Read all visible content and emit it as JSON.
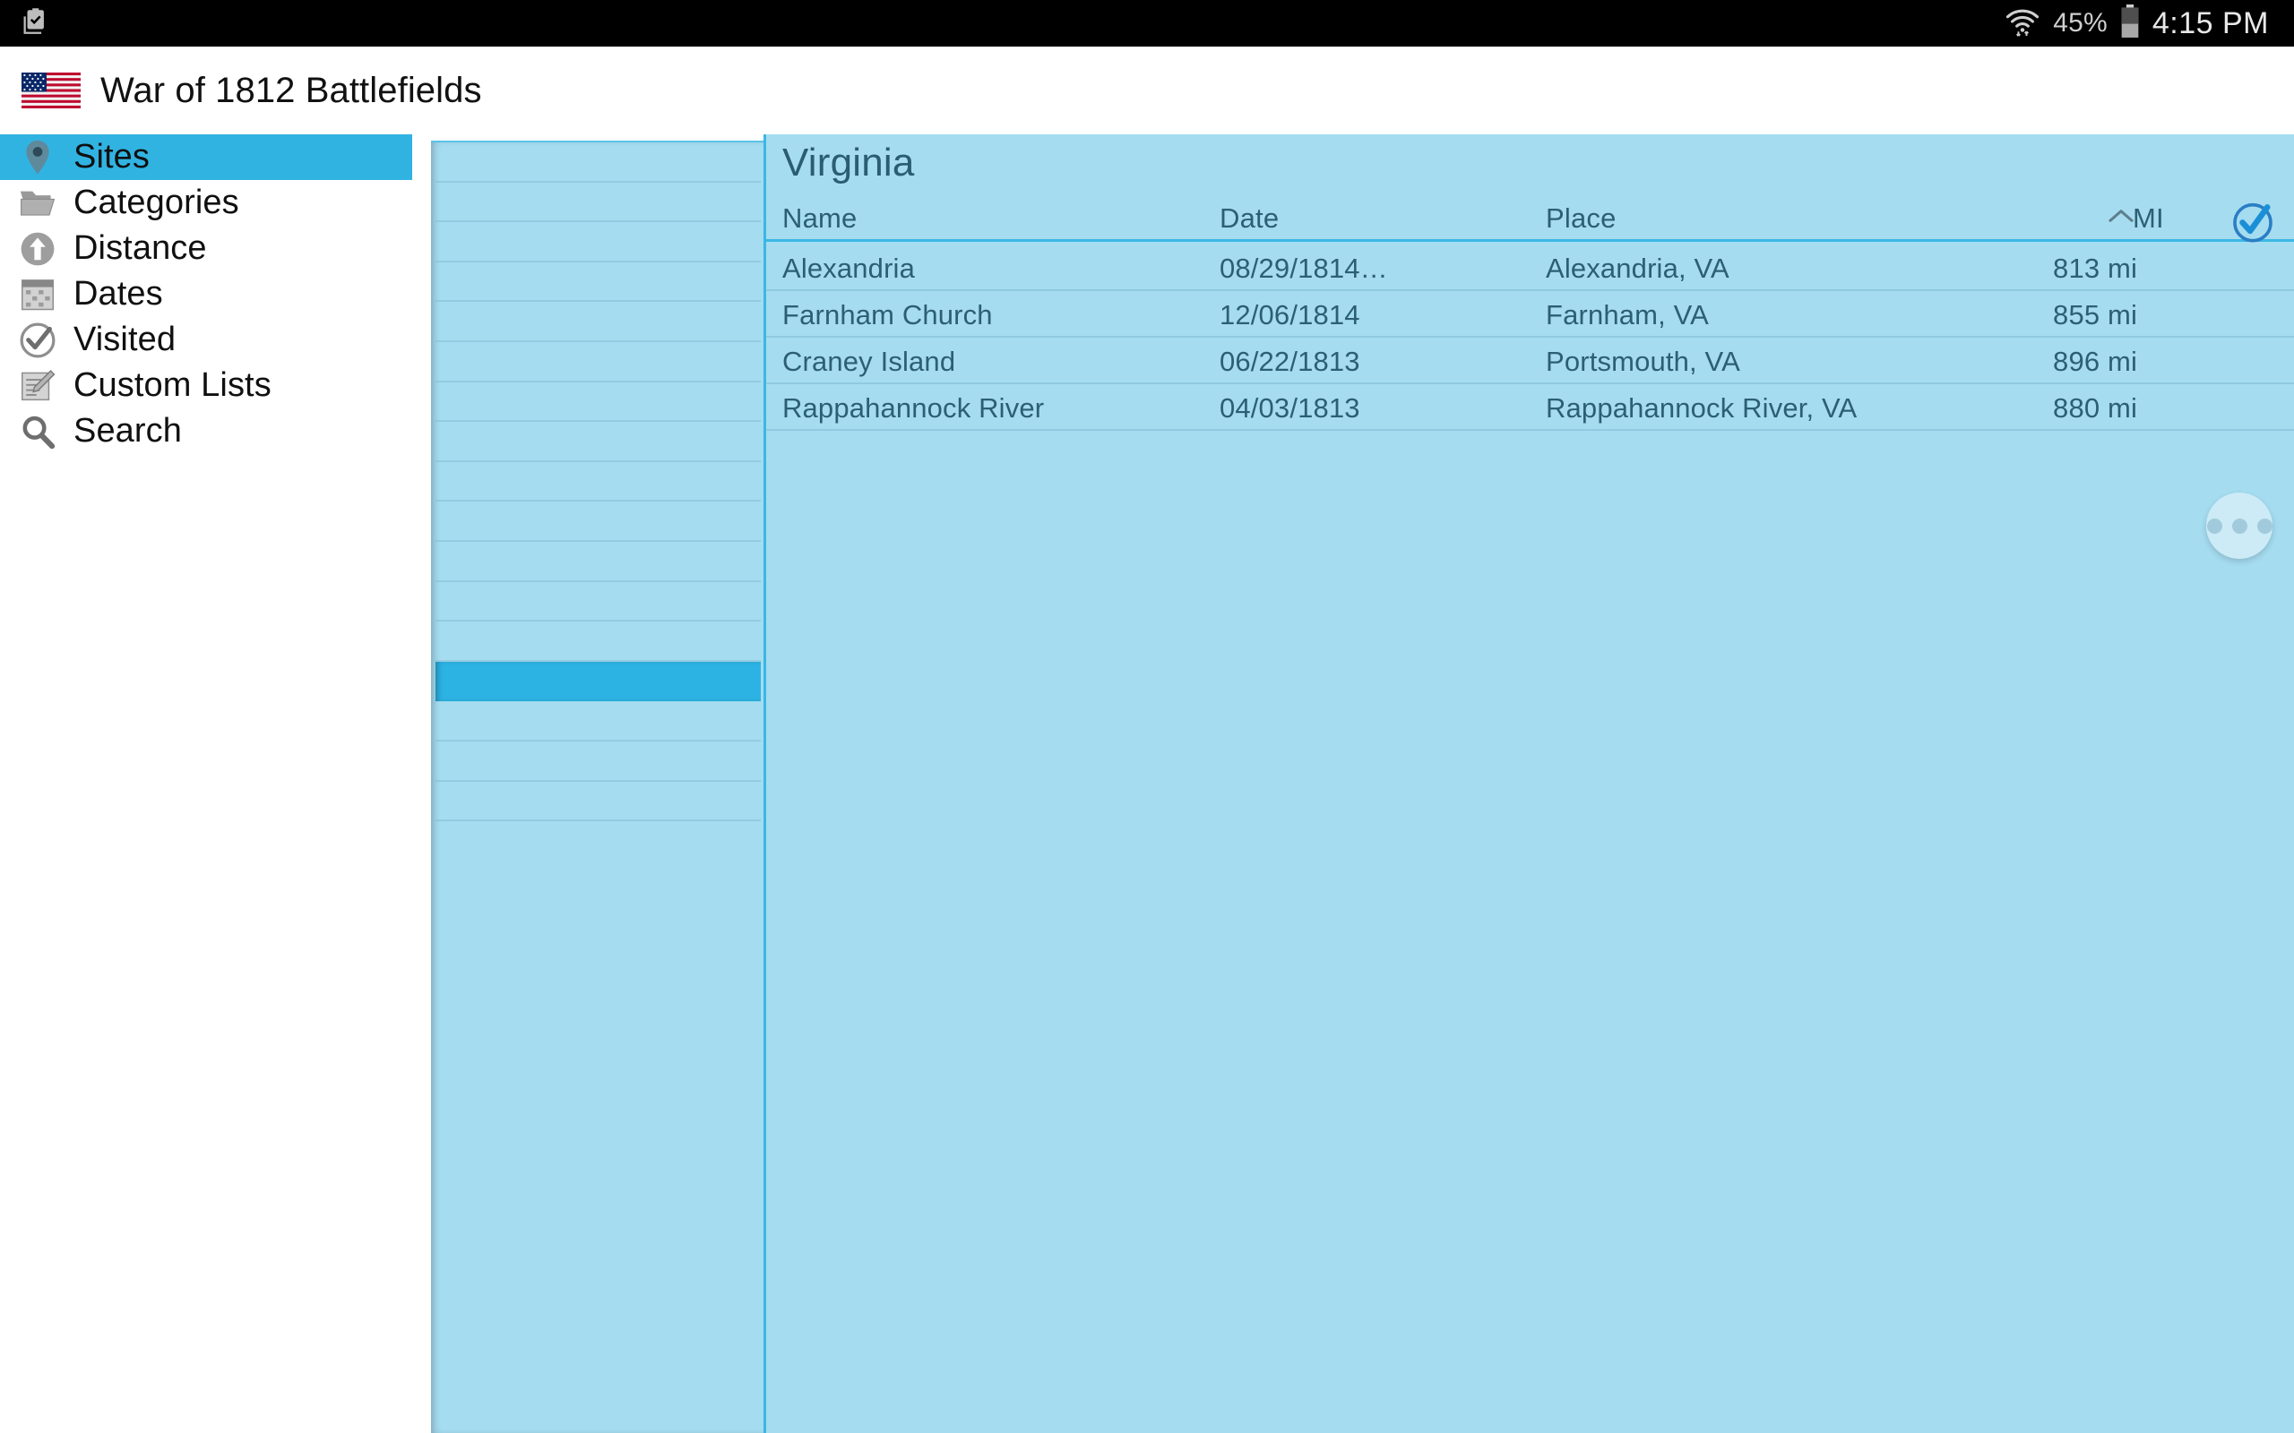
{
  "status_bar": {
    "notification_icon": "clipboard-check-icon",
    "wifi_icon": "wifi-icon",
    "battery_percent": "45%",
    "battery_icon": "battery-icon",
    "time": "4:15 PM"
  },
  "app_bar": {
    "logo_icon": "us-flag-icon",
    "title": "War of 1812 Battlefields"
  },
  "sidebar": {
    "items": [
      {
        "label": "Sites",
        "icon": "map-pin-icon",
        "selected": true
      },
      {
        "label": "Categories",
        "icon": "folder-icon",
        "selected": false
      },
      {
        "label": "Distance",
        "icon": "arrow-up-circle-icon",
        "selected": false
      },
      {
        "label": "Dates",
        "icon": "calendar-icon",
        "selected": false
      },
      {
        "label": "Visited",
        "icon": "check-circle-icon",
        "selected": false
      },
      {
        "label": "Custom Lists",
        "icon": "edit-list-icon",
        "selected": false
      },
      {
        "label": "Search",
        "icon": "search-icon",
        "selected": false
      }
    ]
  },
  "list_panel": {
    "row_count": 19,
    "selected_row_index": 13
  },
  "content": {
    "state_title": "Virginia",
    "select_all_icon": "check-circle-icon",
    "sort_icon": "chevron-up-icon",
    "columns": [
      "Name",
      "Date",
      "Place",
      "MI"
    ],
    "sorted_by": "MI",
    "sort_direction": "ascending",
    "rows": [
      {
        "name": "Alexandria",
        "date": "08/29/1814…",
        "place": "Alexandria, VA",
        "mi": "813 mi"
      },
      {
        "name": "Farnham Church",
        "date": "12/06/1814",
        "place": "Farnham, VA",
        "mi": "855 mi"
      },
      {
        "name": "Craney Island",
        "date": "06/22/1813",
        "place": "Portsmouth, VA",
        "mi": "896 mi"
      },
      {
        "name": "Rappahannock River",
        "date": "04/03/1813",
        "place": "Rappahannock River, VA",
        "mi": "880 mi"
      }
    ],
    "overflow_button_icon": "more-horizontal-icon"
  },
  "colors": {
    "accent": "#31b3e2",
    "panel_background": "#a5dcf0",
    "text": "#2d5f72",
    "status_bar": "#000000"
  }
}
